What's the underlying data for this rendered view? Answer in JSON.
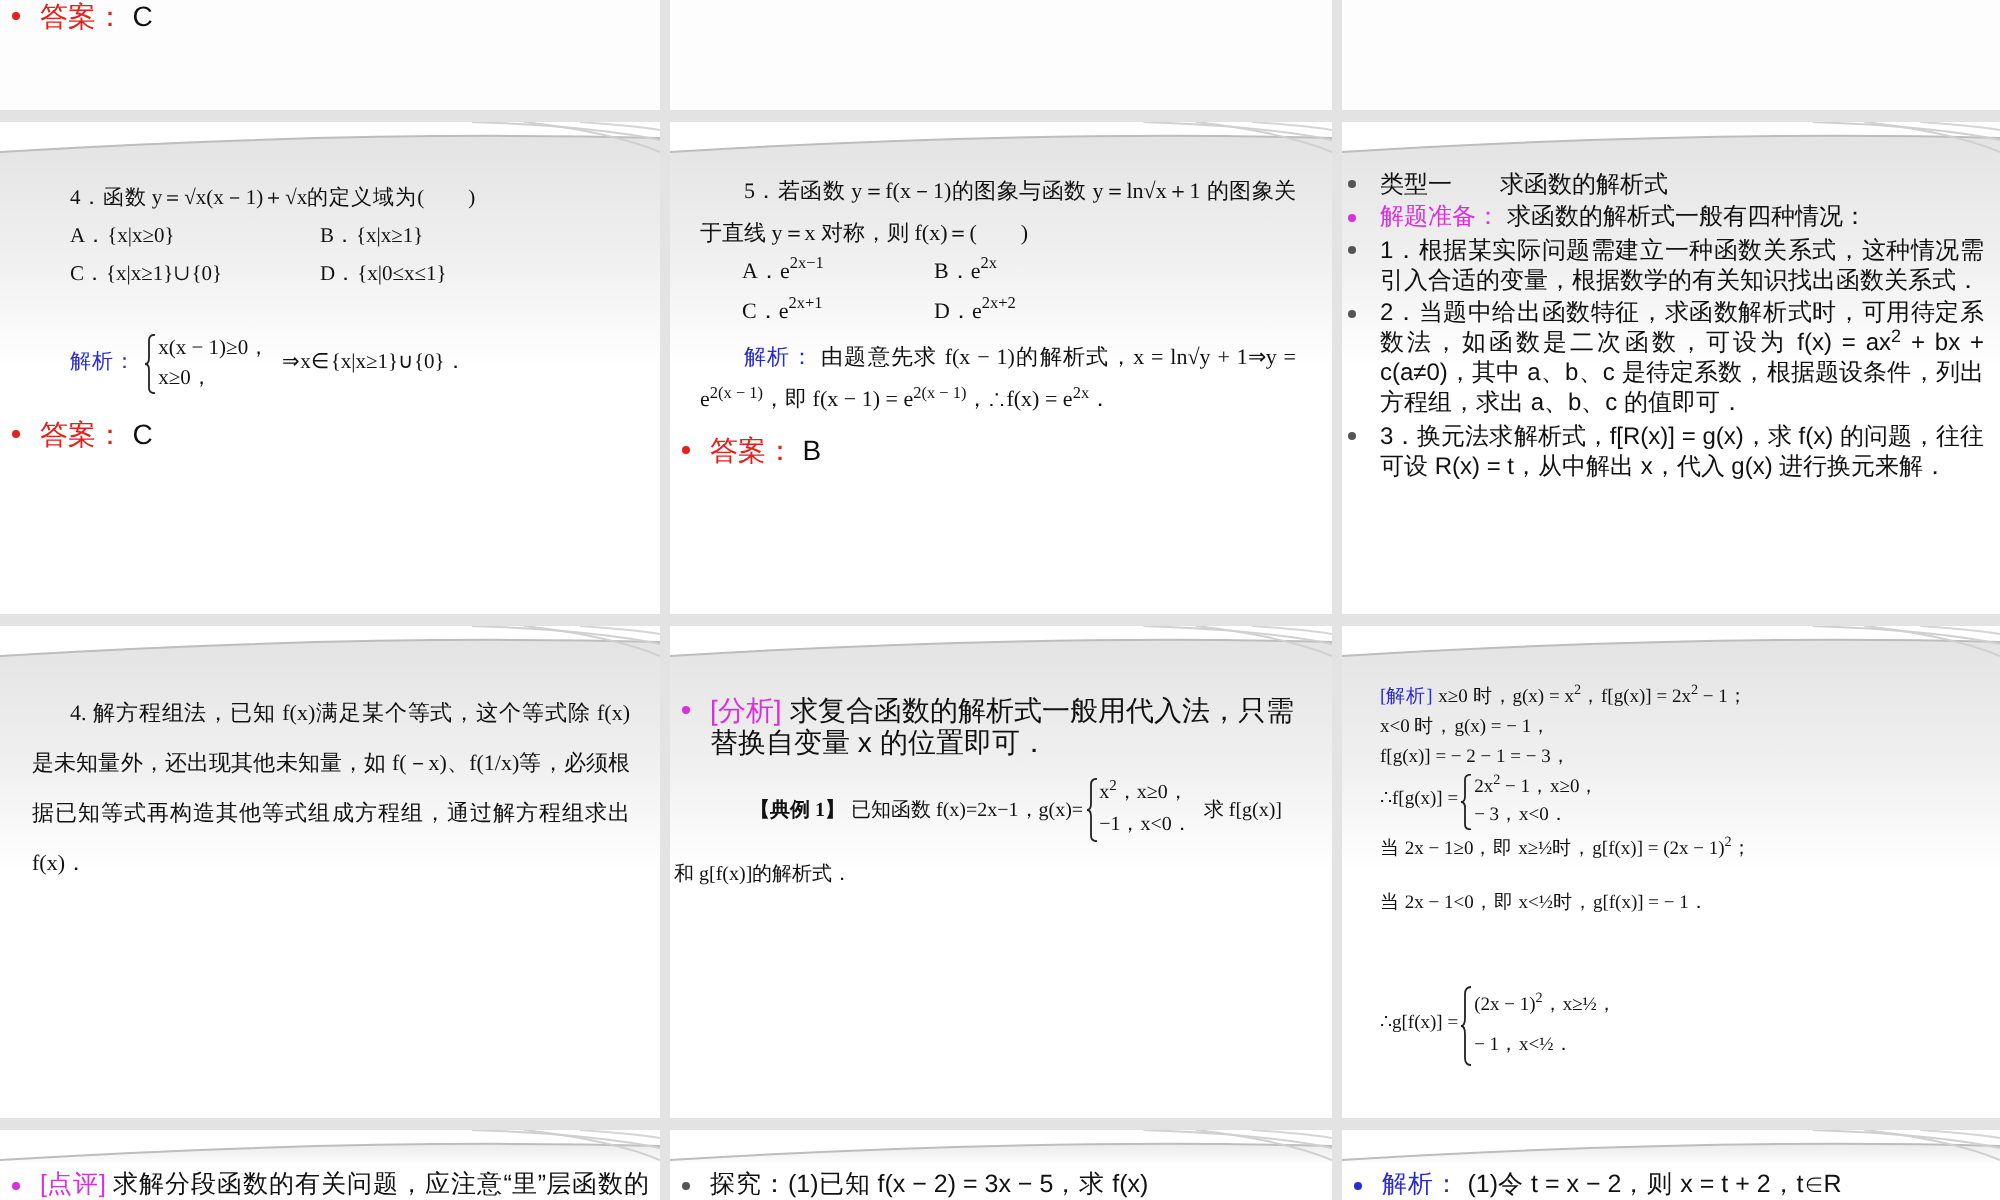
{
  "slides": [
    {
      "kind": "bullets",
      "items": [
        {
          "label": {
            "text": "答案：",
            "kind": "answer"
          },
          "text": "C"
        }
      ]
    },
    {
      "kind": "blank"
    },
    {
      "kind": "blank"
    },
    {
      "kind": "choice_compact",
      "question": "4．函数 y＝√x(x－1)＋√x的定义域为(　　)",
      "options": [
        "A．{x|x≥0}",
        "B．{x|x≥1}",
        "C．{x|x≥1}∪{0}",
        "D．{x|0≤x≤1}"
      ],
      "analysis": {
        "label": {
          "text": "解析：",
          "kind": "analysis"
        },
        "cases": [
          "x(x − 1)≥0，",
          "x≥0，"
        ],
        "tail": "⇒x∈{x|x≥1}∪{0}．"
      },
      "answer": {
        "label": {
          "text": "答案：",
          "kind": "answer"
        },
        "text": "C"
      }
    },
    {
      "kind": "choice",
      "question": "5．若函数 y＝f(x－1)的图象与函数 y＝ln√x＋1 的图象关于直线 y＝x 对称，则 f(x)＝(　　)",
      "options": [
        "A．e$^{2x−1}$",
        "B．e$^{2x}$",
        "C．e$^{2x+1}$",
        "D．e$^{2x+2}$"
      ],
      "analysis": {
        "label": {
          "text": "解析：",
          "kind": "analysis"
        },
        "text": "由题意先求 f(x − 1)的解析式，x = ln√y + 1⇒y = e$^{2(x − 1)}$，即 f(x − 1) = e$^{2(x − 1)}$，∴f(x) = e$^{2x}$．"
      },
      "answer": {
        "label": {
          "text": "答案：",
          "kind": "answer"
        },
        "text": "B"
      }
    },
    {
      "kind": "outline",
      "items": [
        {
          "text": "类型一　　求函数的解析式"
        },
        {
          "label": {
            "text": "解题准备：",
            "kind": "note"
          },
          "text": "求函数的解析式一般有四种情况："
        },
        {
          "text": "1．根据某实际问题需建立一种函数关系式，这种情况需引入合适的变量，根据数学的有关知识找出函数关系式．"
        },
        {
          "text": "2．当题中给出函数特征，求函数解析式时，可用待定系数法，如函数是二次函数，可设为 f(x) = ax$^{2}$ + bx + c(a≠0)，其中 a、b、c 是待定系数，根据题设条件，列出方程组，求出 a、b、c 的值即可．"
        },
        {
          "text": "3．换元法求解析式，f[R(x)] = g(x)，求 f(x) 的问题，往往可设 R(x) = t，从中解出 x，代入 g(x) 进行换元来解．"
        }
      ]
    },
    {
      "kind": "paragraph",
      "text": "4. 解方程组法，已知 f(x)满足某个等式，这个等式除 f(x)是未知量外，还出现其他未知量，如 f(－x)、f(1/x)等，必须根据已知等式再构造其他等式组成方程组，通过解方程组求出 f(x)．"
    },
    {
      "kind": "example",
      "note": {
        "label": {
          "text": "[分析]",
          "kind": "note"
        },
        "text": "求复合函数的解析式一般用代入法，只需替换自变量 x 的位置即可．"
      },
      "example": {
        "label": {
          "text": "【典例 1】",
          "kind": "example"
        },
        "lead": "已知函数 f(x)=2x−1，g(x)=",
        "cases": [
          "x$^{2}$，x≥0，",
          "−1，x<0．"
        ],
        "tail": "求 f[g(x)]",
        "continuation": "和 g[f(x)]的解析式．"
      }
    },
    {
      "kind": "solution",
      "lines": [
        {
          "kind": "text",
          "label": {
            "text": "[解析]",
            "kind": "analysis"
          },
          "text": "x≥0 时，g(x) = x$^{2}$，f[g(x)] = 2x$^{2}$ − 1；"
        },
        {
          "kind": "text",
          "text": "x<0 时，g(x) = − 1，"
        },
        {
          "kind": "text",
          "text": "f[g(x)] = − 2 − 1 = − 3，"
        },
        {
          "kind": "cases",
          "lead": "∴f[g(x)] =",
          "cases": [
            "2x$^{2}$ − 1，x≥0，",
            "− 3，x<0．"
          ]
        },
        {
          "kind": "text",
          "text": "当 2x − 1≥0，即 x≥½时，g[f(x)] = (2x − 1)$^{2}$；"
        },
        {
          "kind": "text",
          "text": "当 2x − 1<0，即 x<½时，g[f(x)] = − 1．"
        },
        {
          "kind": "cases",
          "lead": "∴g[f(x)] =",
          "cases": [
            "(2x − 1)$^{2}$，x≥½，",
            "− 1，x<½．"
          ]
        }
      ]
    },
    {
      "kind": "bullets",
      "items": [
        {
          "label": {
            "text": "[点评]",
            "kind": "note"
          },
          "text": "求解分段函数的有关问题，应注意“里”层函数的"
        }
      ]
    },
    {
      "kind": "bullets",
      "items": [
        {
          "text": "探究：(1)已知 f(x − 2) = 3x − 5，求 f(x)"
        }
      ]
    },
    {
      "kind": "bullets",
      "items": [
        {
          "label": {
            "text": "解析：",
            "kind": "analysis"
          },
          "text": "(1)令 t = x − 2，则 x = t + 2，t∈R"
        }
      ]
    }
  ]
}
